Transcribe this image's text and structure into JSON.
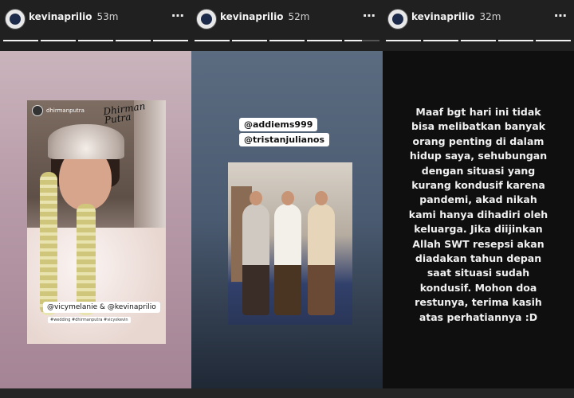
{
  "stories": [
    {
      "username": "kevinaprilio",
      "time": "53m",
      "more_icon": "⋯",
      "progress": [
        1,
        1,
        1,
        1,
        1
      ],
      "credit_account": "dhirmanputra",
      "signature": "Dhirman Putra",
      "mention": "@vicymelanie & @kevinaprilio",
      "tags": "#wedding #dhirmanputra #vicyxkevin"
    },
    {
      "username": "kevinaprilio",
      "time": "52m",
      "more_icon": "⋯",
      "progress": [
        1,
        1,
        1,
        1,
        0.5
      ],
      "mention_1": "@addiems999",
      "mention_2": "@tristanjulianos"
    },
    {
      "username": "kevinaprilio",
      "time": "32m",
      "more_icon": "⋯",
      "progress": [
        1,
        1,
        1,
        1,
        1
      ],
      "message_lines": [
        "Maaf bgt hari ini tidak",
        "bisa melibatkan banyak",
        "orang penting di dalam",
        "hidup saya, sehubungan",
        "dengan situasi yang",
        "kurang kondusif karena",
        "pandemi, akad nikah",
        "kami hanya dihadiri oleh",
        "keluarga. Jika diijinkan",
        "Allah SWT resepsi akan",
        "diadakan tahun depan",
        "saat situasi sudah",
        "kondusif. Mohon doa",
        "restunya, terima kasih",
        "atas perhatiannya :D"
      ]
    }
  ]
}
